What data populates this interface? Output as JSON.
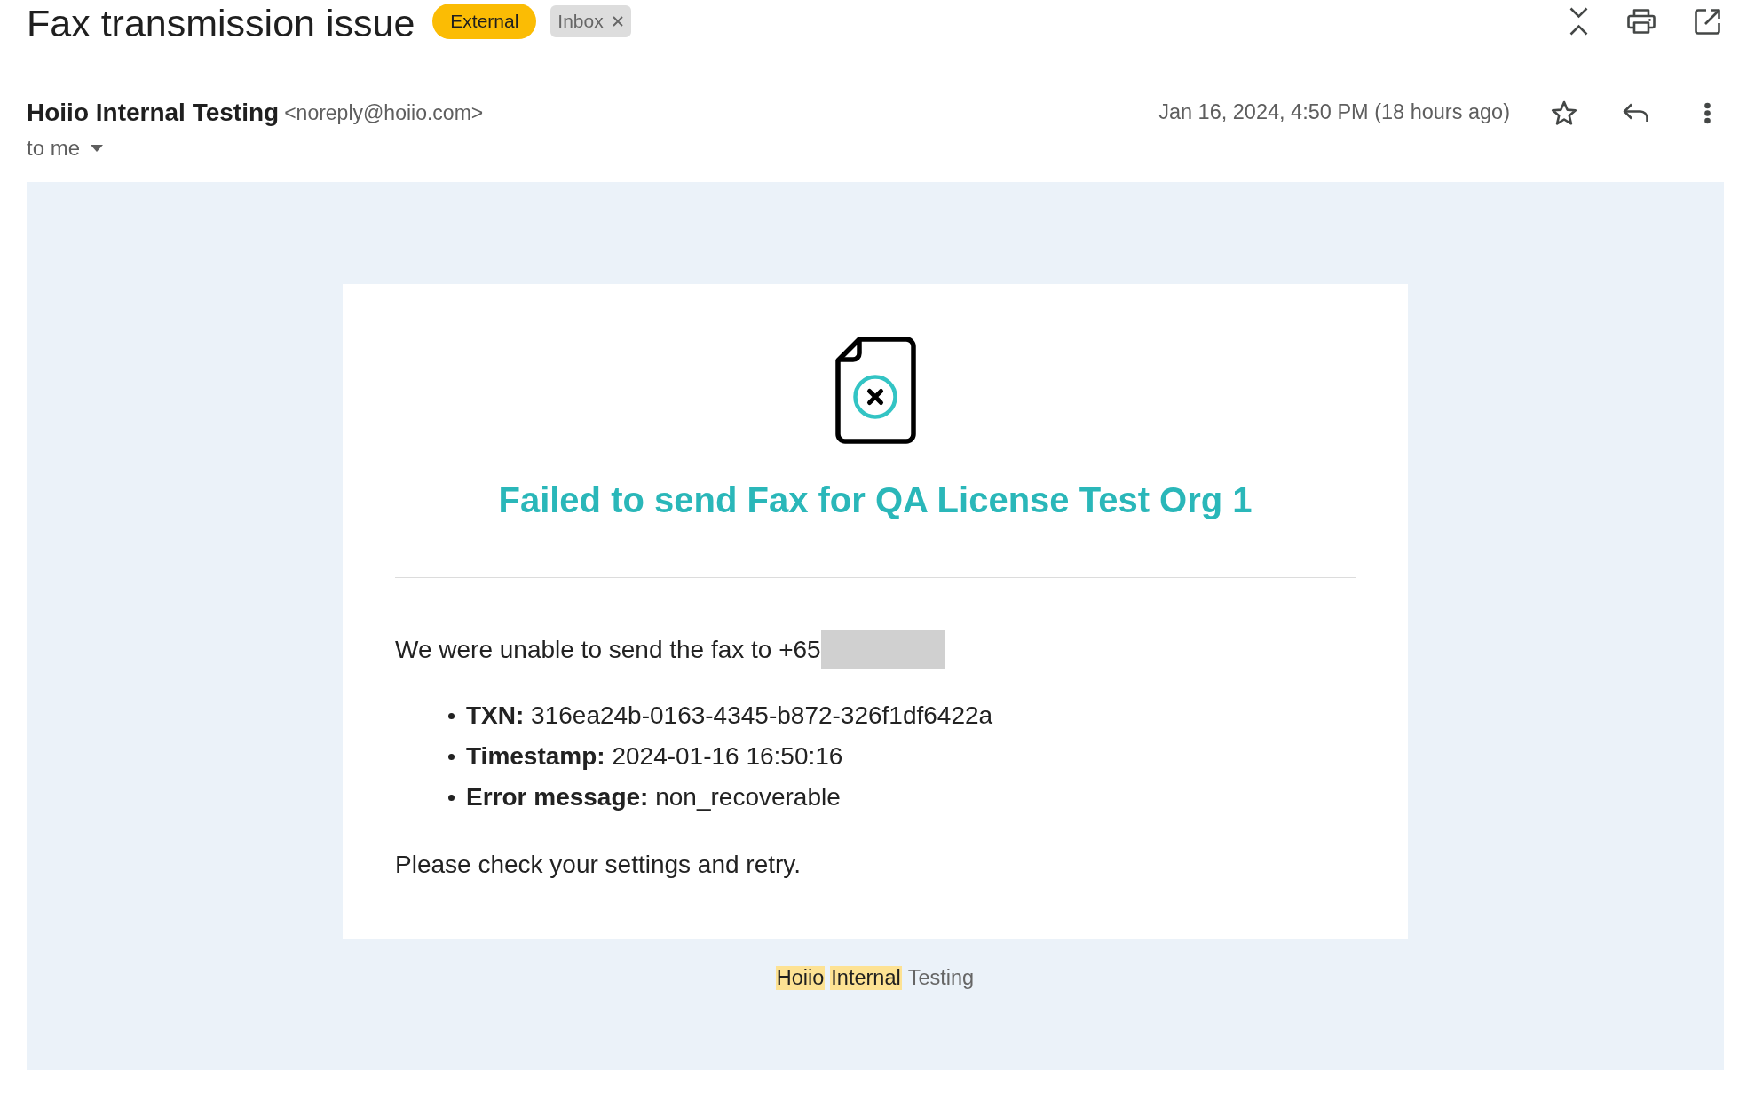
{
  "subject": {
    "title": "Fax transmission issue",
    "labels": [
      {
        "text": "External",
        "kind": "category",
        "color": "#fbbc04",
        "removable": false
      },
      {
        "text": "Inbox",
        "kind": "folder",
        "color": "#dddddd",
        "removable": true
      }
    ]
  },
  "message": {
    "sender_name": "Hoiio Internal Testing",
    "sender_email": "<noreply@hoiio.com>",
    "recipients": "to me",
    "date": "Jan 16, 2024, 4:50 PM (18 hours ago)",
    "starred": false
  },
  "body": {
    "heading": "Failed to send Fax for QA License Test Org 1",
    "intro": "We were unable to send the fax to +65",
    "number_redacted": true,
    "details": [
      "**TXN:** 316ea24b-0163-4345-b872-326f1df6422a",
      "**Timestamp:** 2024-01-16 16:50:16",
      "**Error message:** non_recoverable"
    ],
    "closing": "Please check your settings and retry."
  },
  "footer": {
    "words": [
      {
        "text": "Hoiio",
        "highlighted": true
      },
      {
        "text": "Internal",
        "highlighted": true
      },
      {
        "text": "Testing",
        "highlighted": false
      }
    ]
  }
}
